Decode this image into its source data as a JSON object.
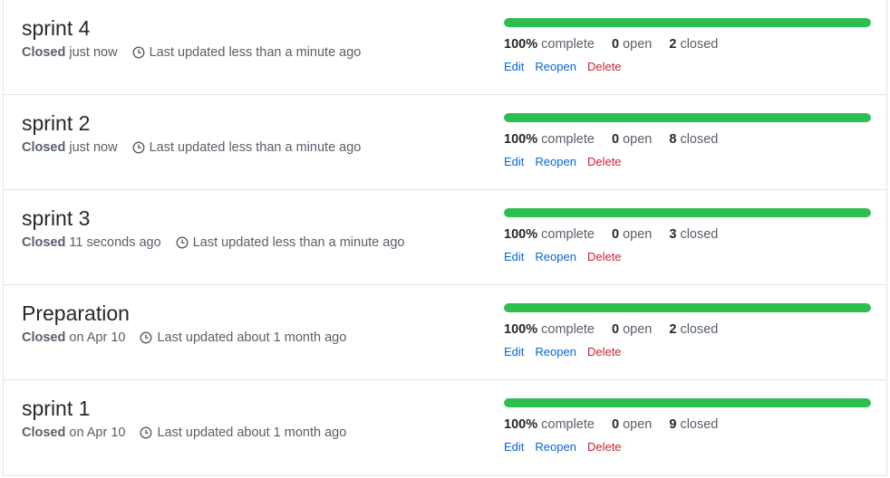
{
  "labels": {
    "closed": "Closed",
    "complete": "complete",
    "open": "open",
    "closed_suffix": "closed",
    "edit": "Edit",
    "reopen": "Reopen",
    "delete": "Delete"
  },
  "colors": {
    "progress": "#2cbe4e",
    "link": "#0366d6",
    "danger": "#cb2431"
  },
  "milestones": [
    {
      "title": "sprint 4",
      "closed_when": "just now",
      "updated": "Last updated less than a minute ago",
      "percent_label": "100%",
      "percent": 1.0,
      "open_count": "0",
      "closed_count": "2"
    },
    {
      "title": "sprint 2",
      "closed_when": "just now",
      "updated": "Last updated less than a minute ago",
      "percent_label": "100%",
      "percent": 1.0,
      "open_count": "0",
      "closed_count": "8"
    },
    {
      "title": "sprint 3",
      "closed_when": "11 seconds ago",
      "updated": "Last updated less than a minute ago",
      "percent_label": "100%",
      "percent": 1.0,
      "open_count": "0",
      "closed_count": "3"
    },
    {
      "title": "Preparation",
      "closed_when": "on Apr 10",
      "updated": "Last updated about 1 month ago",
      "percent_label": "100%",
      "percent": 1.0,
      "open_count": "0",
      "closed_count": "2"
    },
    {
      "title": "sprint 1",
      "closed_when": "on Apr 10",
      "updated": "Last updated about 1 month ago",
      "percent_label": "100%",
      "percent": 1.0,
      "open_count": "0",
      "closed_count": "9"
    }
  ]
}
